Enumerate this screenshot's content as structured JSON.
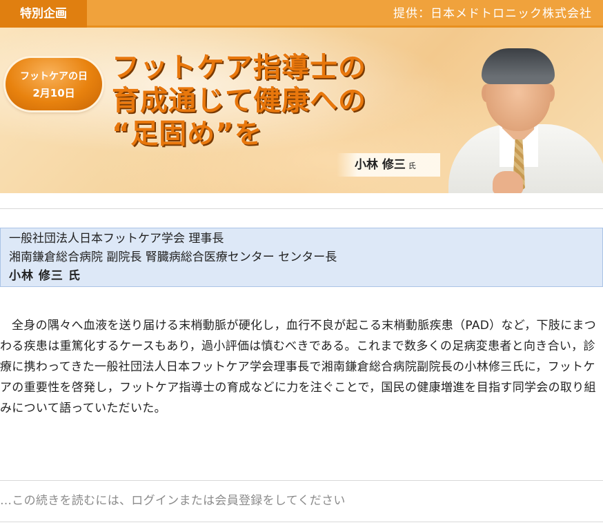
{
  "header": {
    "tag": "特別企画",
    "provider": "提供：日本メドトロニック株式会社"
  },
  "banner": {
    "badge_line1": "フットケアの日",
    "badge_line2": "2月10日",
    "headline_lines": [
      "フットケア指導士の",
      "育成通じて健康への",
      "“足固め”を"
    ],
    "person_name": "小林 修三",
    "person_suffix": "氏"
  },
  "affiliation": {
    "line1": "一般社団法人日本フットケア学会 理事長",
    "line2": "湘南鎌倉総合病院 副院長 腎臓病総合医療センター センター長",
    "name": "小林 修三 氏"
  },
  "article": {
    "body": "全身の隅々へ血液を送り届ける末梢動脈が硬化し，血行不良が起こる末梢動脈疾患（PAD）など，下肢にまつわる疾患は重篤化するケースもあり，過小評価は慎むべきである。これまで数多くの足病変患者と向き合い，診療に携わってきた一般社団法人日本フットケア学会理事長で湘南鎌倉総合病院副院長の小林修三氏に，フットケアの重要性を啓発し，フットケア指導士の育成などに力を注ぐことで，国民の健康増進を目指す同学会の取り組みについて語っていただいた。",
    "login_prompt": "…この続きを読むには、ログインまたは会員登録をしてください"
  }
}
